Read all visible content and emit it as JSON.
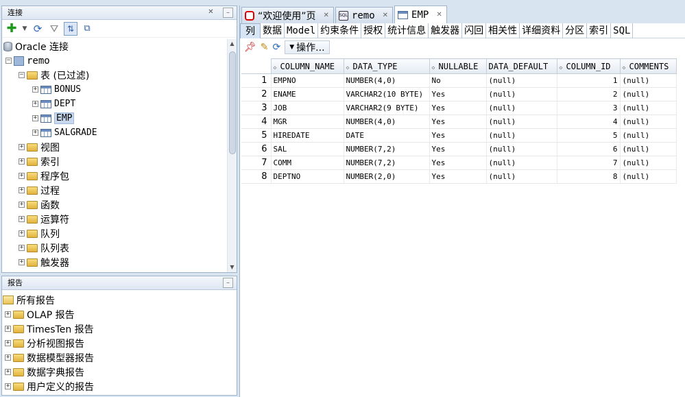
{
  "connections_panel": {
    "title": "连接",
    "tree": {
      "root_label": "Oracle 连接",
      "connection_label": "remo",
      "tables_folder_label": "表 (已过滤)",
      "tables": [
        "BONUS",
        "DEPT",
        "EMP",
        "SALGRADE"
      ],
      "selected_table": "EMP",
      "folders": [
        "视图",
        "索引",
        "程序包",
        "过程",
        "函数",
        "运算符",
        "队列",
        "队列表",
        "触发器"
      ]
    }
  },
  "reports_panel": {
    "title": "报告",
    "root_label": "所有报告",
    "items": [
      "OLAP 报告",
      "TimesTen 报告",
      "分析视图报告",
      "数据模型器报告",
      "数据字典报告",
      "用户定义的报告"
    ]
  },
  "editor": {
    "doc_tabs": [
      {
        "label": "“欢迎使用”页",
        "icon": "oracle-icon"
      },
      {
        "label": "remo",
        "icon": "sql-worksheet-icon"
      },
      {
        "label": "EMP",
        "icon": "table-icon"
      }
    ],
    "active_doc_tab": "EMP",
    "sub_tabs": [
      "列",
      "数据",
      "Model",
      "约束条件",
      "授权",
      "统计信息",
      "触发器",
      "闪回",
      "相关性",
      "详细资料",
      "分区",
      "索引",
      "SQL"
    ],
    "active_sub_tab": "列",
    "actions_label": "操作...",
    "columns_grid": {
      "headers": [
        "COLUMN_NAME",
        "DATA_TYPE",
        "NULLABLE",
        "DATA_DEFAULT",
        "COLUMN_ID",
        "COMMENTS"
      ],
      "rows": [
        {
          "n": "1",
          "cells": [
            "EMPNO",
            "NUMBER(4,0)",
            "No",
            "(null)",
            "1",
            "(null)"
          ]
        },
        {
          "n": "2",
          "cells": [
            "ENAME",
            "VARCHAR2(10 BYTE)",
            "Yes",
            "(null)",
            "2",
            "(null)"
          ]
        },
        {
          "n": "3",
          "cells": [
            "JOB",
            "VARCHAR2(9 BYTE)",
            "Yes",
            "(null)",
            "3",
            "(null)"
          ]
        },
        {
          "n": "4",
          "cells": [
            "MGR",
            "NUMBER(4,0)",
            "Yes",
            "(null)",
            "4",
            "(null)"
          ]
        },
        {
          "n": "5",
          "cells": [
            "HIREDATE",
            "DATE",
            "Yes",
            "(null)",
            "5",
            "(null)"
          ]
        },
        {
          "n": "6",
          "cells": [
            "SAL",
            "NUMBER(7,2)",
            "Yes",
            "(null)",
            "6",
            "(null)"
          ]
        },
        {
          "n": "7",
          "cells": [
            "COMM",
            "NUMBER(7,2)",
            "Yes",
            "(null)",
            "7",
            "(null)"
          ]
        },
        {
          "n": "8",
          "cells": [
            "DEPTNO",
            "NUMBER(2,0)",
            "Yes",
            "(null)",
            "8",
            "(null)"
          ]
        }
      ]
    }
  },
  "colors": {
    "chrome_bg": "#d9e4f1",
    "selection": "#c7d8ee",
    "border": "#9fb3cb"
  }
}
